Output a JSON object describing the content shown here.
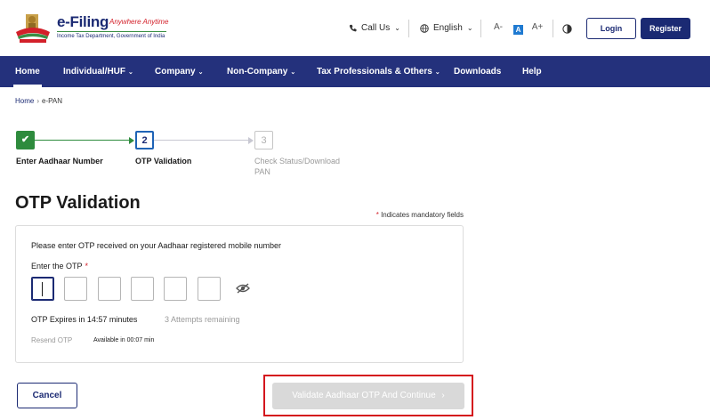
{
  "header": {
    "logo": {
      "title": "e-Filing",
      "tagline": "Anywhere Anytime",
      "subtitle": "Income Tax Department, Government of India"
    },
    "call_us": "Call Us",
    "language": "English",
    "font_sizes": [
      "A-",
      "A",
      "A+"
    ],
    "login_label": "Login",
    "register_label": "Register"
  },
  "nav": {
    "items": [
      {
        "label": "Home",
        "has_dropdown": false,
        "active": true
      },
      {
        "label": "Individual/HUF",
        "has_dropdown": true
      },
      {
        "label": "Company",
        "has_dropdown": true
      },
      {
        "label": "Non-Company",
        "has_dropdown": true
      },
      {
        "label": "Tax Professionals & Others",
        "has_dropdown": true
      },
      {
        "label": "Downloads",
        "has_dropdown": false
      },
      {
        "label": "Help",
        "has_dropdown": false
      }
    ],
    "chevron": "⌄"
  },
  "breadcrumb": {
    "home": "Home",
    "separator": "›",
    "current": "e-PAN"
  },
  "stepper": {
    "steps": [
      {
        "number": "1",
        "label": "Enter Aadhaar Number",
        "status": "done"
      },
      {
        "number": "2",
        "label": "OTP Validation",
        "status": "current"
      },
      {
        "number": "3",
        "label": "Check Status/Download PAN",
        "status": "pending"
      }
    ],
    "done_mark": "✔"
  },
  "page": {
    "title": "OTP Validation",
    "mandatory_star": "*",
    "mandatory_note": "Indicates mandatory fields"
  },
  "otp_card": {
    "instruction": "Please enter OTP received on your Aadhaar registered mobile number",
    "field_label": "Enter the OTP",
    "required_star": "*",
    "digits": [
      "",
      "",
      "",
      "",
      "",
      ""
    ],
    "expires_text": "OTP Expires in 14:57 minutes",
    "attempts_text": "3 Attempts remaining",
    "resend_label": "Resend OTP",
    "available_text": "Available in 00:07 min"
  },
  "actions": {
    "cancel_label": "Cancel",
    "validate_label": "Validate Aadhaar OTP And Continue",
    "validate_enabled": false
  },
  "colors": {
    "primary": "#1b2a73",
    "nav_bg": "#24317c",
    "success": "#2e8b3d",
    "highlight": "#d4161d",
    "disabled": "#d9d9d9"
  }
}
